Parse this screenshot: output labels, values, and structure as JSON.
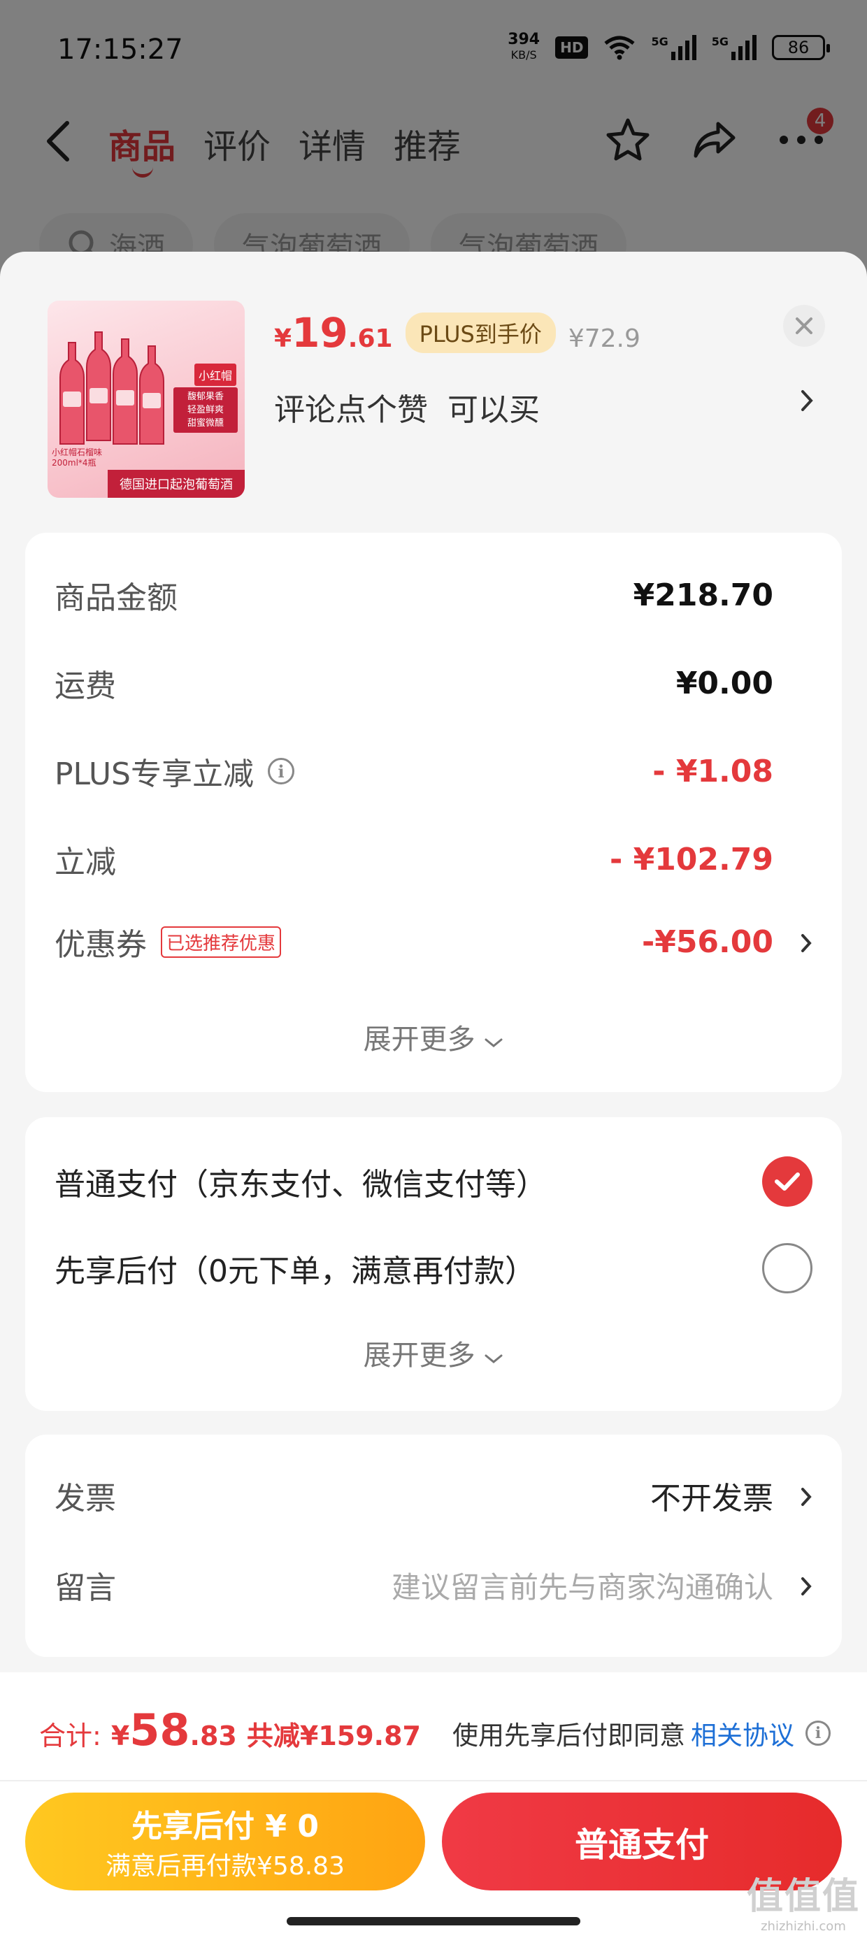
{
  "status_bar": {
    "time": "17:15:27",
    "net_speed_value": "394",
    "net_speed_unit": "KB/S",
    "hd_label": "HD",
    "signal1_label": "5G",
    "signal2_label": "5G",
    "battery": "86"
  },
  "nav": {
    "tabs": [
      "商品",
      "评价",
      "详情",
      "推荐"
    ],
    "active_tab": "商品",
    "badge_count": "4",
    "icons": [
      "back-icon",
      "star-icon",
      "share-icon",
      "more-icon"
    ]
  },
  "search_pills": [
    {
      "text": "海酒",
      "icon": "search-icon"
    },
    {
      "text": "气泡葡萄酒"
    },
    {
      "text": "气泡葡萄酒"
    }
  ],
  "product": {
    "price_currency": "¥",
    "price_integer": "19",
    "price_decimal": ".61",
    "plus_badge": "PLUS到手价",
    "original_price": "¥72.9",
    "title": "评论点个赞  可以买",
    "image": {
      "tag_name": "小红帽",
      "tag_features": "馥郁果香\n轻盈鲜爽\n甜蜜微醺",
      "caption": "小红帽石榴味\n200ml*4瓶",
      "banner": "德国进口起泡葡萄酒"
    }
  },
  "price_details": {
    "rows": [
      {
        "label": "商品金额",
        "value": "¥218.70"
      },
      {
        "label": "运费",
        "value": "¥0.00"
      },
      {
        "label": "PLUS专享立减",
        "value": "- ¥1.08"
      },
      {
        "label": "立减",
        "value": "- ¥102.79"
      },
      {
        "label": "优惠券",
        "tag": "已选推荐优惠",
        "value": "-¥56.00"
      }
    ],
    "expand_label": "展开更多"
  },
  "payment": {
    "options": [
      {
        "label": "普通支付（京东支付、微信支付等）",
        "selected": true
      },
      {
        "label": "先享后付（0元下单，满意再付款）",
        "selected": false
      }
    ],
    "expand_label": "展开更多"
  },
  "extras": {
    "invoice_label": "发票",
    "invoice_value": "不开发票",
    "message_label": "留言",
    "message_placeholder": "建议留言前先与商家沟通确认"
  },
  "footer": {
    "total_label": "合计:",
    "total_currency": "¥",
    "total_integer": "58",
    "total_decimal": ".83",
    "total_saved": "共减¥159.87",
    "agree_text": "使用先享后付即同意",
    "agree_link": "相关协议",
    "later_title": "先享后付 ¥ 0",
    "later_subtitle": "满意后再付款¥58.83",
    "pay_button": "普通支付"
  },
  "watermark": {
    "main": "值值值",
    "sub": "zhizhizhi.com"
  },
  "colors": {
    "accent_red": "#e4393c",
    "plus_gold": "#fbe6b8",
    "later_button": "#ffb31a",
    "link_blue": "#1d6fd6"
  }
}
